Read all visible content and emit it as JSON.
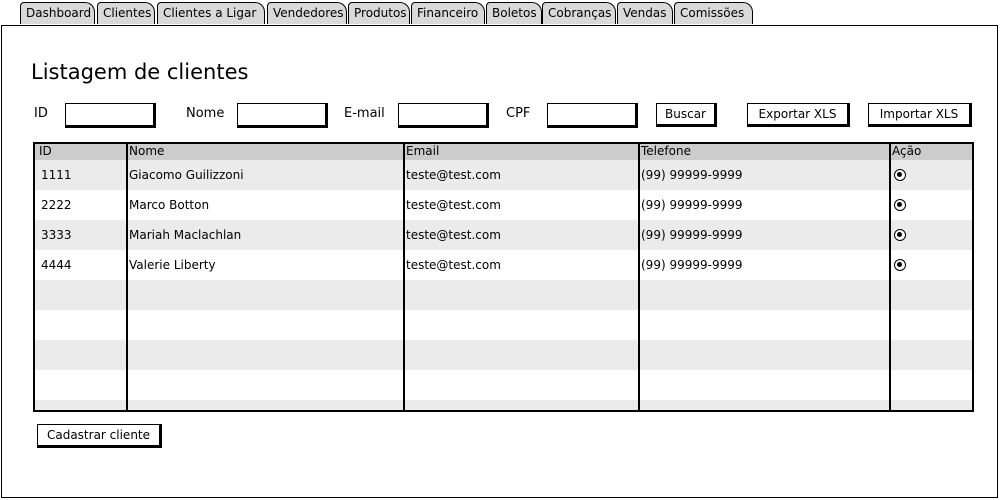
{
  "tabs": [
    {
      "label": "Dashboard"
    },
    {
      "label": "Clientes"
    },
    {
      "label": "Clientes a Ligar"
    },
    {
      "label": "Vendedores"
    },
    {
      "label": "Produtos"
    },
    {
      "label": "Financeiro"
    },
    {
      "label": "Boletos"
    },
    {
      "label": "Cobranças"
    },
    {
      "label": "Vendas"
    },
    {
      "label": "Comissões"
    }
  ],
  "active_tab": "Clientes",
  "page": {
    "title": "Listagem de clientes"
  },
  "filters": {
    "id_label": "ID",
    "id_value": "",
    "nome_label": "Nome",
    "nome_value": "",
    "email_label": "E-mail",
    "email_value": "",
    "cpf_label": "CPF",
    "cpf_value": ""
  },
  "buttons": {
    "search": "Buscar",
    "export": "Exportar XLS",
    "import": "Importar XLS",
    "create": "Cadastrar cliente"
  },
  "table": {
    "columns": [
      "ID",
      "Nome",
      "Email",
      "Telefone",
      "Ação"
    ],
    "rows": [
      {
        "id": "1111",
        "nome": "Giacomo Guilizzoni",
        "email": "teste@test.com",
        "telefone": "(99) 99999-9999",
        "acao": "selected"
      },
      {
        "id": "2222",
        "nome": "Marco Botton",
        "email": "teste@test.com",
        "telefone": "(99) 99999-9999",
        "acao": "selected"
      },
      {
        "id": "3333",
        "nome": "Mariah Maclachlan",
        "email": "teste@test.com",
        "telefone": "(99) 99999-9999",
        "acao": "selected"
      },
      {
        "id": "4444",
        "nome": "Valerie Liberty",
        "email": "teste@test.com",
        "telefone": "(99) 99999-9999",
        "acao": "selected"
      }
    ]
  },
  "colors": {
    "tab_bg": "#d9d9d9",
    "header_bg": "#cccccc",
    "alt_row_bg": "#ebebeb",
    "border": "#000000"
  },
  "icons": {
    "row_action": "radio-selected-icon"
  }
}
